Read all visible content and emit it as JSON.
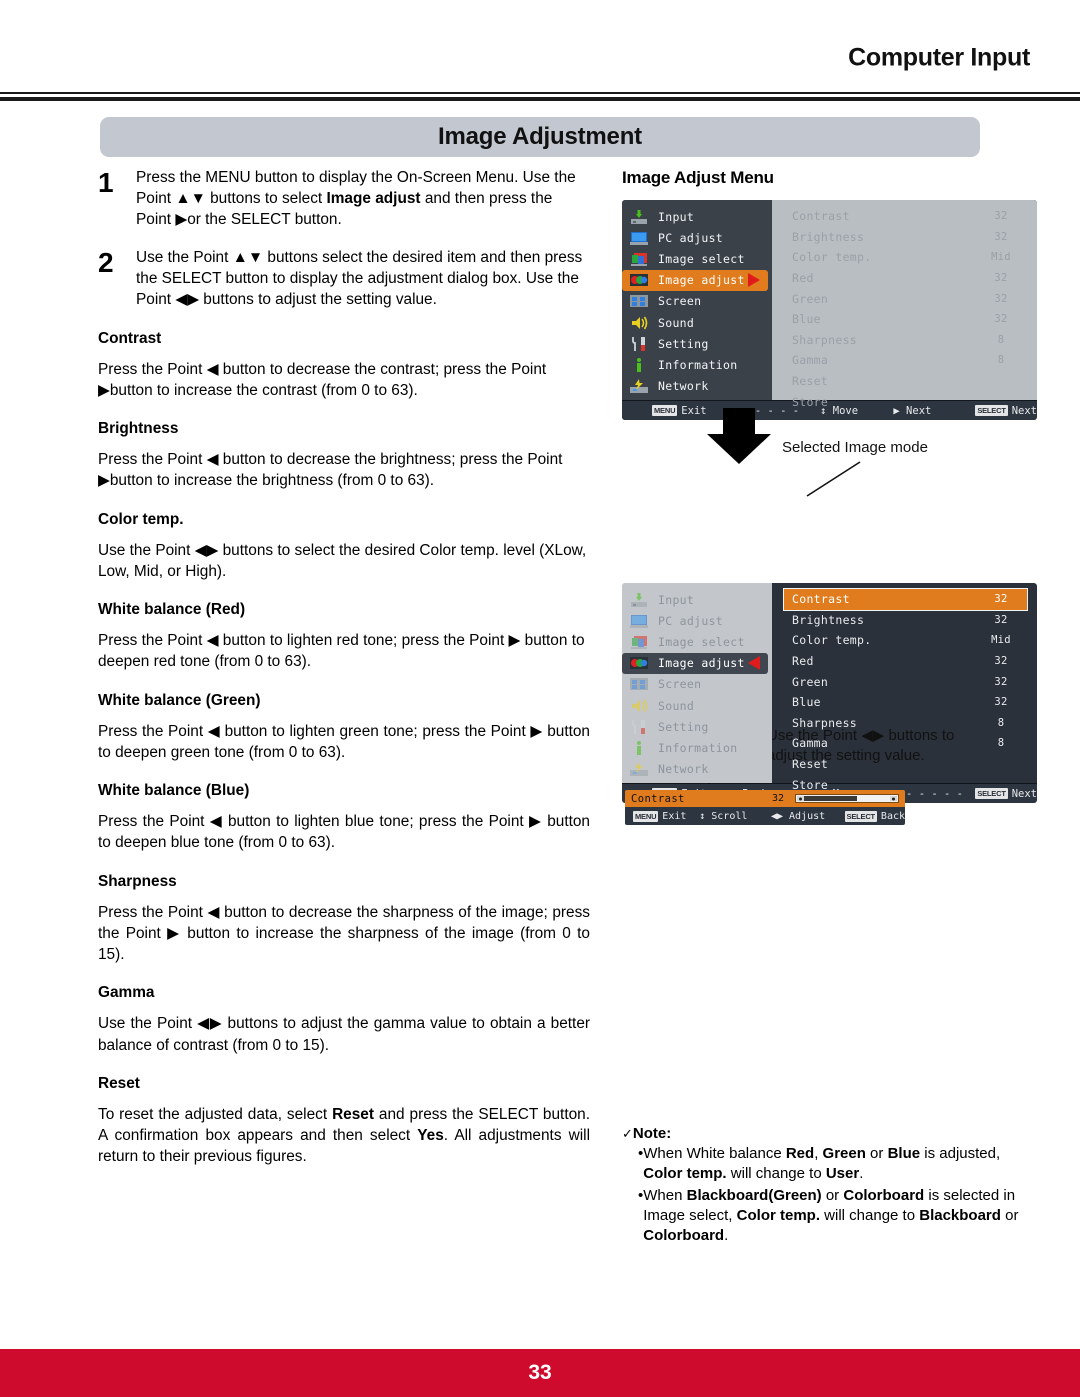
{
  "header": {
    "title": "Computer Input"
  },
  "section": {
    "title": "Image Adjustment"
  },
  "steps": [
    {
      "num": "1",
      "html": "Press the MENU button to display the On-Screen Menu. Use the Point ▲▼ buttons to select <b>Image adjust</b> and then press the Point ▶or the SELECT button."
    },
    {
      "num": "2",
      "html": "Use the Point ▲▼ buttons select the desired item and then press the SELECT button to display the adjustment dialog box. Use the Point ◀▶ buttons to adjust the setting value."
    }
  ],
  "sections": [
    {
      "heading": "Contrast",
      "body": "Press the Point ◀ button to decrease the contrast; press the Point ▶button to increase the contrast (from 0 to 63)."
    },
    {
      "heading": "Brightness",
      "body": "Press the Point ◀ button to decrease the brightness; press the Point ▶button to increase the brightness (from 0 to 63)."
    },
    {
      "heading": "Color temp.",
      "body": "Use the Point ◀▶ buttons to select the desired Color temp. level (XLow, Low, Mid, or High)."
    },
    {
      "heading": "White balance (Red)",
      "body": "Press the Point ◀ button to lighten red tone; press the Point ▶ button to deepen red tone (from 0 to 63)."
    },
    {
      "heading": "White balance (Green)",
      "body": "Press the Point ◀ button to lighten green tone; press the Point ▶ button to deepen green tone (from 0 to 63)."
    },
    {
      "heading": "White balance (Blue)",
      "body": "Press the Point ◀ button to lighten blue tone; press the Point ▶ button to deepen blue tone (from 0 to 63)."
    },
    {
      "heading": "Sharpness",
      "body": "Press the Point ◀ button to decrease the sharpness of the image; press the Point ▶ button to increase the sharpness of the image (from 0 to 15)."
    },
    {
      "heading": "Gamma",
      "body": "Use the Point ◀▶ buttons to adjust the gamma value to obtain a better balance of contrast (from 0 to 15)."
    },
    {
      "heading": "Reset",
      "body_html": "To reset the adjusted data, select <b>Reset</b> and press the SELECT button. A confirmation box appears and then select <b>Yes</b>. All adjustments will return to their previous figures."
    }
  ],
  "osd": {
    "title": "Image Adjust Menu",
    "sidebar": [
      {
        "label": "Input",
        "icon": "input-icon"
      },
      {
        "label": "PC adjust",
        "icon": "monitor-icon"
      },
      {
        "label": "Image select",
        "icon": "image-select-icon"
      },
      {
        "label": "Image adjust",
        "icon": "image-adjust-icon"
      },
      {
        "label": "Screen",
        "icon": "screen-icon"
      },
      {
        "label": "Sound",
        "icon": "speaker-icon"
      },
      {
        "label": "Setting",
        "icon": "tools-icon"
      },
      {
        "label": "Information",
        "icon": "info-icon"
      },
      {
        "label": "Network",
        "icon": "network-icon"
      }
    ],
    "selected_index": 3,
    "items": [
      {
        "name": "Contrast",
        "value": "32"
      },
      {
        "name": "Brightness",
        "value": "32"
      },
      {
        "name": "Color temp.",
        "value": "Mid"
      },
      {
        "name": "Red",
        "value": "32"
      },
      {
        "name": "Green",
        "value": "32"
      },
      {
        "name": "Blue",
        "value": "32"
      },
      {
        "name": "Sharpness",
        "value": "8"
      },
      {
        "name": "Gamma",
        "value": "8"
      },
      {
        "name": "Reset",
        "value": ""
      },
      {
        "name": "Store",
        "value": ""
      }
    ],
    "menu1_footer": [
      {
        "key": "MENU",
        "label": "Exit"
      },
      {
        "key": "",
        "label": "◀ - - - - -"
      },
      {
        "key": "",
        "label": "↕ Move"
      },
      {
        "key": "",
        "label": "▶ Next"
      },
      {
        "key": "SELECT",
        "label": "Next"
      }
    ],
    "menu2_footer": [
      {
        "key": "MENU",
        "label": "Exit"
      },
      {
        "key": "",
        "label": "◀ Back"
      },
      {
        "key": "",
        "label": "↕ Move"
      },
      {
        "key": "",
        "label": "▶ - - - - -"
      },
      {
        "key": "SELECT",
        "label": "Next"
      }
    ],
    "callout": "Selected Image mode",
    "adjust_hint": "Use the Point ◀▶ buttons to adjust the setting value.",
    "dialog": {
      "name": "Contrast",
      "value": "32",
      "footer": [
        {
          "key": "MENU",
          "label": "Exit"
        },
        {
          "key": "",
          "label": "↕ Scroll"
        },
        {
          "key": "",
          "label": "◀▶ Adjust"
        },
        {
          "key": "SELECT",
          "label": "Back"
        }
      ]
    }
  },
  "note": {
    "head": "Note:",
    "check": "✓",
    "items": [
      "When White balance <b>Red</b>, <b>Green</b> or <b>Blue</b> is adjusted, <b>Color temp.</b> will change to <b>User</b>.",
      "When <b>Blackboard(Green)</b> or <b>Colorboard</b> is selected in Image select, <b>Color temp.</b> will change to <b>Blackboard</b> or <b>Colorboard</b>."
    ]
  },
  "footer": {
    "page": "33"
  },
  "colors": {
    "brand_red": "#ce0a2d",
    "accent_orange": "#e07c1e",
    "banner_gray": "#c3c8d0",
    "osd_dark": "#3a4149",
    "osd_light": "#c3c7cb"
  }
}
